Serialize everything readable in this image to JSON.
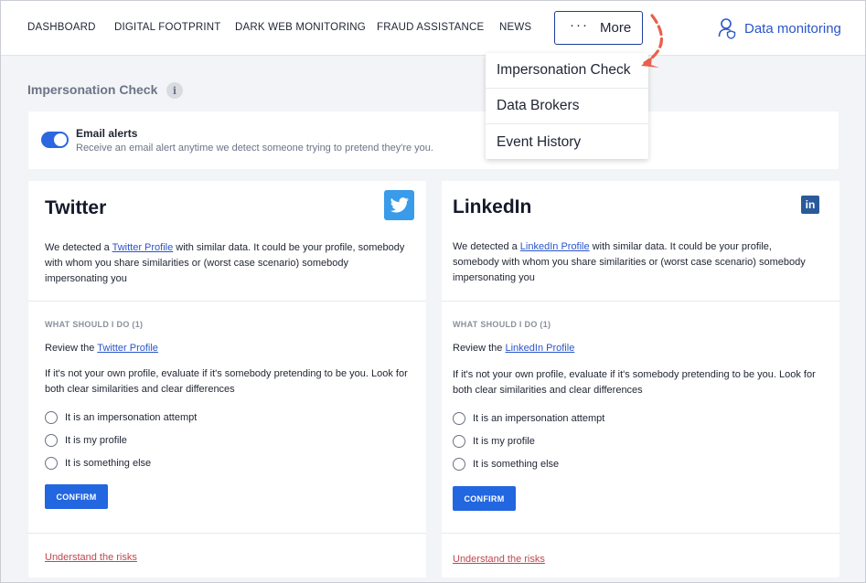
{
  "nav": {
    "items": [
      "DASHBOARD",
      "DIGITAL FOOTPRINT",
      "DARK WEB MONITORING",
      "FRAUD ASSISTANCE",
      "NEWS"
    ],
    "more_label": "More",
    "more_dots": "···",
    "data_monitoring_label": "Data monitoring"
  },
  "dropdown": {
    "items": [
      "Impersonation Check",
      "Data Brokers",
      "Event History"
    ]
  },
  "page": {
    "title": "Impersonation Check",
    "info_glyph": "i"
  },
  "alerts": {
    "title": "Email alerts",
    "description": "Receive an email alert anytime we detect someone trying to pretend they're you.",
    "enabled": true
  },
  "cards": [
    {
      "title": "Twitter",
      "detected_prefix": "We detected a ",
      "profile_link": "Twitter Profile",
      "detected_suffix": " with similar data. It could be your profile, somebody with whom you share similarities or (worst case scenario) somebody impersonating you",
      "section_heading": "WHAT SHOULD I DO (1)",
      "review_prefix": "Review the ",
      "review_link": "Twitter Profile",
      "evaluate_text": "If it's not your own profile, evaluate if it's somebody pretending to be you. Look for both clear similarities and clear differences",
      "options": [
        "It is an impersonation attempt",
        "It is my profile",
        "It is something else"
      ],
      "confirm_label": "CONFIRM",
      "risks_link": "Understand the risks"
    },
    {
      "title": "LinkedIn",
      "detected_prefix": "We detected a ",
      "profile_link": "LinkedIn Profile",
      "detected_suffix": " with similar data. It could be your profile, somebody with whom you share similarities or (worst case scenario) somebody impersonating you",
      "section_heading": "WHAT SHOULD I DO (1)",
      "review_prefix": "Review the ",
      "review_link": "LinkedIn Profile",
      "evaluate_text": "If it's not your own profile, evaluate if it's somebody pretending to be you. Look for both clear similarities and clear differences",
      "options": [
        "It is an impersonation attempt",
        "It is my profile",
        "It is something else"
      ],
      "confirm_label": "CONFIRM",
      "risks_link": "Understand the risks"
    }
  ],
  "brand_icons": {
    "twitter": "twitter-bird-icon",
    "linkedin": "linkedin-in-icon",
    "linkedin_glyph": "in"
  },
  "colors": {
    "accent": "#2266e0",
    "link": "#2a55c9",
    "danger_link": "#c0474f",
    "annotation": "#e8604c",
    "twitter": "#3a9bea",
    "linkedin": "#2a5a9a"
  }
}
